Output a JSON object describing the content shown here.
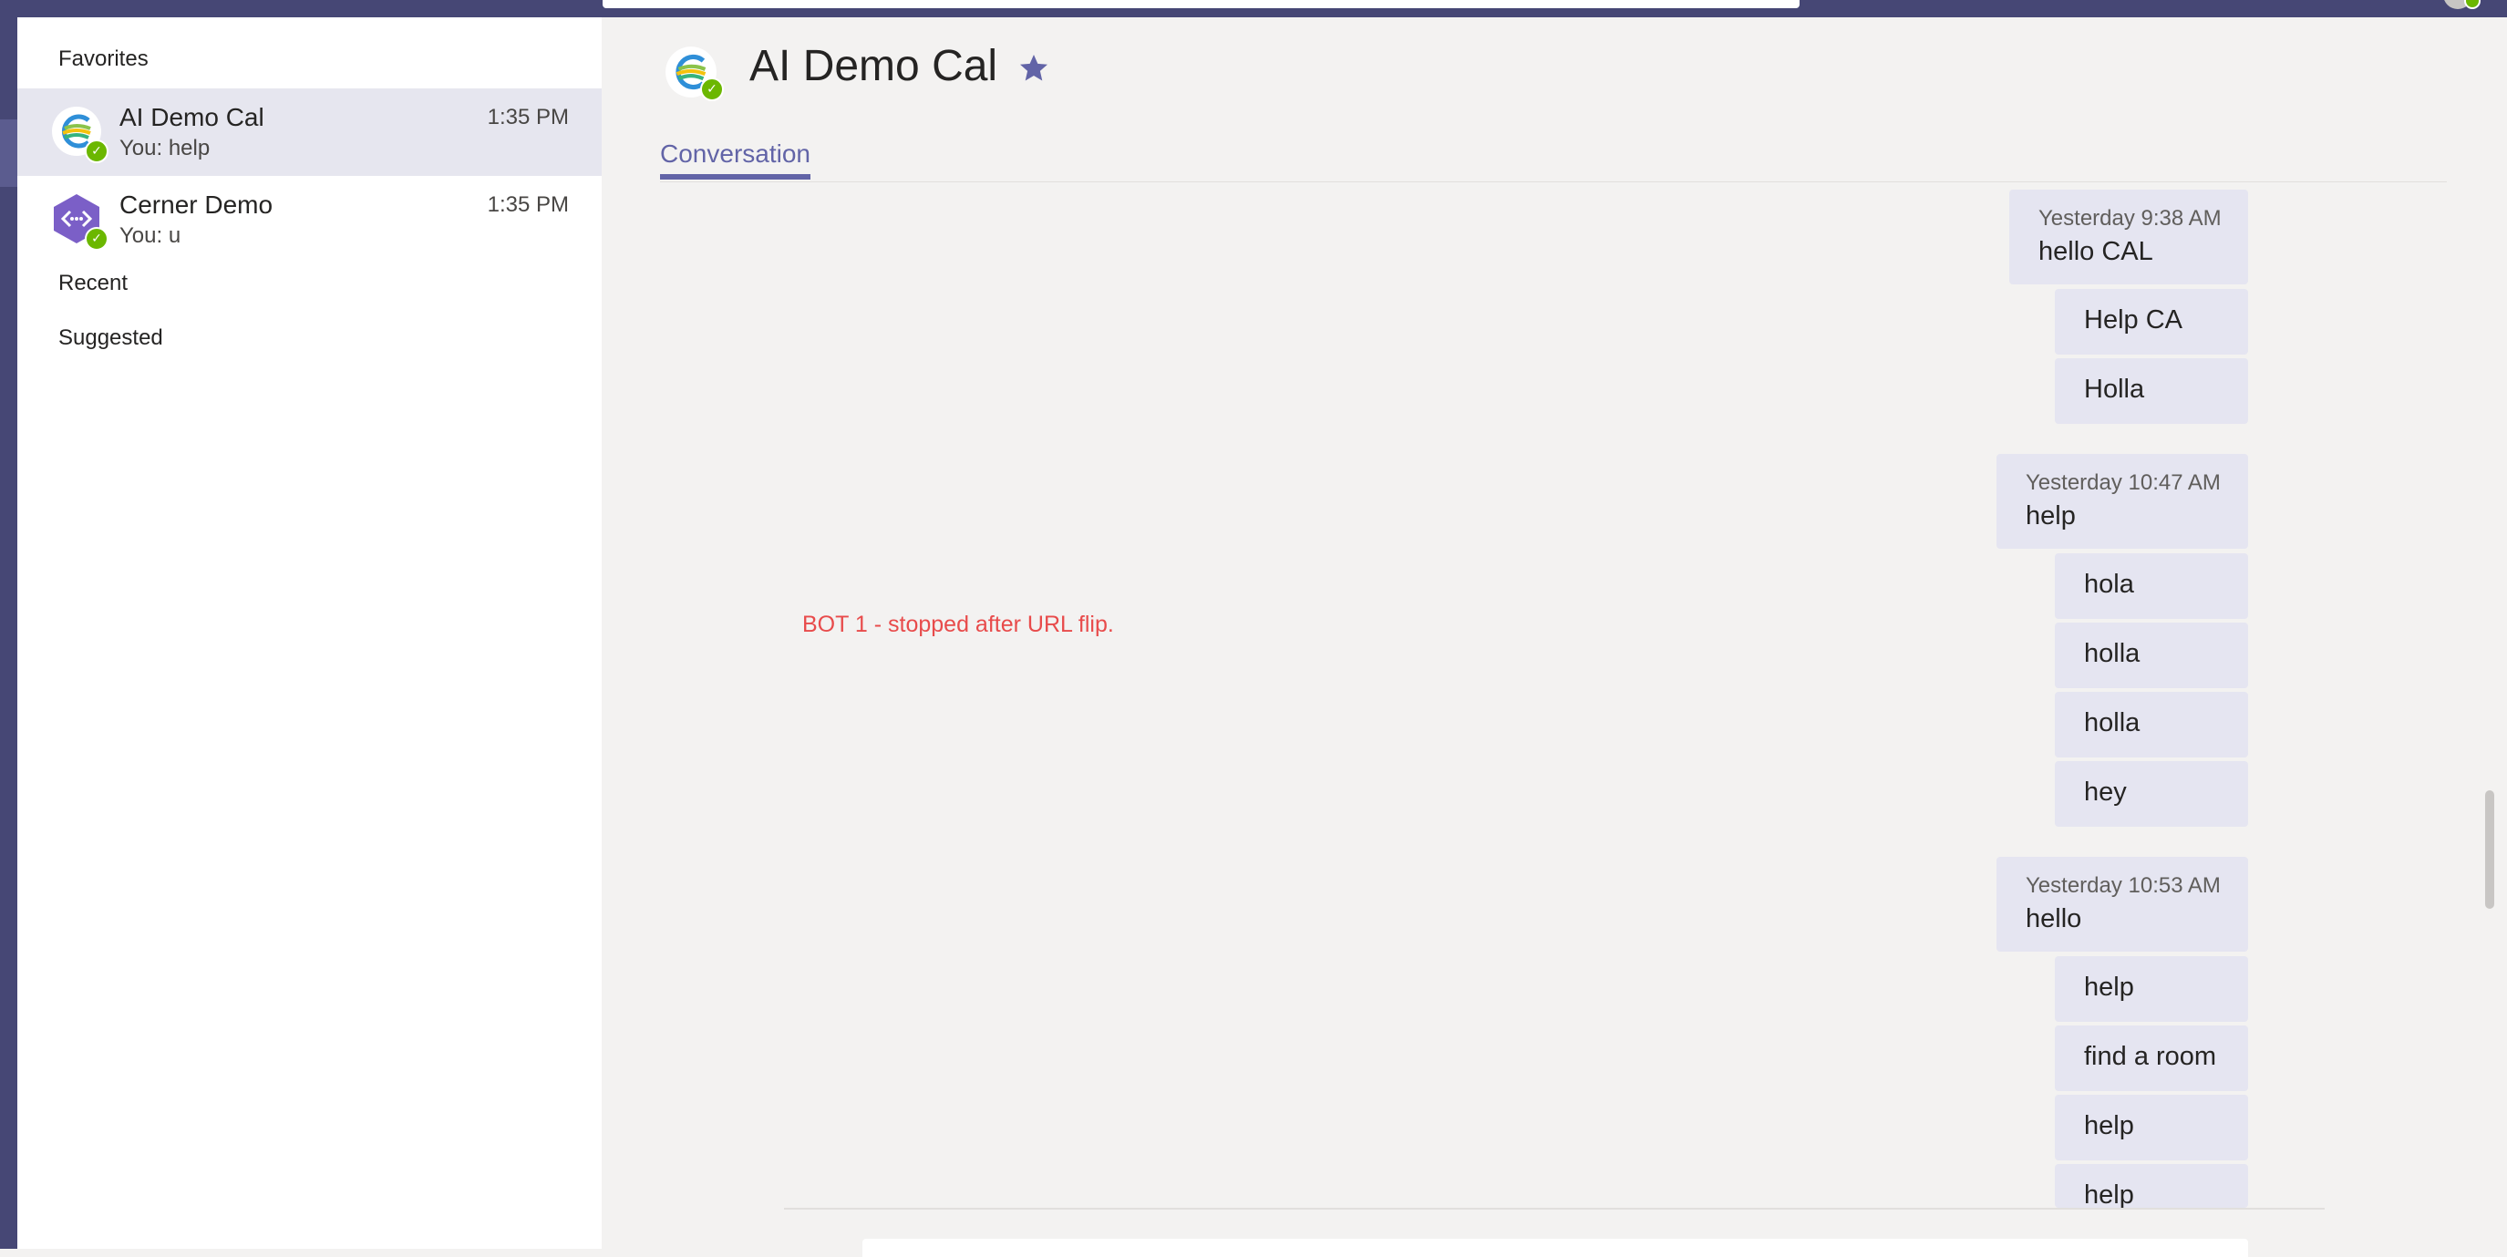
{
  "sidebar": {
    "favorites_label": "Favorites",
    "recent_label": "Recent",
    "suggested_label": "Suggested",
    "chats": [
      {
        "name": "AI Demo Cal",
        "preview": "You: help",
        "time": "1:35 PM",
        "avatar_icon": "ai-demo-cal-logo-icon",
        "active": true
      },
      {
        "name": "Cerner Demo",
        "preview": "You: u",
        "time": "1:35 PM",
        "avatar_icon": "bot-hexagon-icon",
        "active": false
      }
    ]
  },
  "header": {
    "title": "AI Demo Cal",
    "favorite_icon": "star-icon"
  },
  "tabs": [
    {
      "label": "Conversation",
      "active": true
    }
  ],
  "annotation": "BOT 1 - stopped after URL flip.",
  "conversation": {
    "groups": [
      {
        "timestamp": "Yesterday 9:38 AM",
        "first_message": "hello CAL",
        "messages": [
          "Help CA",
          "Holla"
        ]
      },
      {
        "timestamp": "Yesterday 10:47 AM",
        "first_message": "help",
        "messages": [
          "hola",
          "holla",
          "holla",
          "hey"
        ]
      },
      {
        "timestamp": "Yesterday 10:53 AM",
        "first_message": "hello",
        "messages": [
          "help",
          "find a room",
          "help",
          "help"
        ]
      }
    ]
  },
  "colors": {
    "accent": "#6264a7",
    "rail": "#464775",
    "presence_available": "#6bb700",
    "annotation_red": "#e84b4b",
    "bubble": "#e5e5f1"
  }
}
